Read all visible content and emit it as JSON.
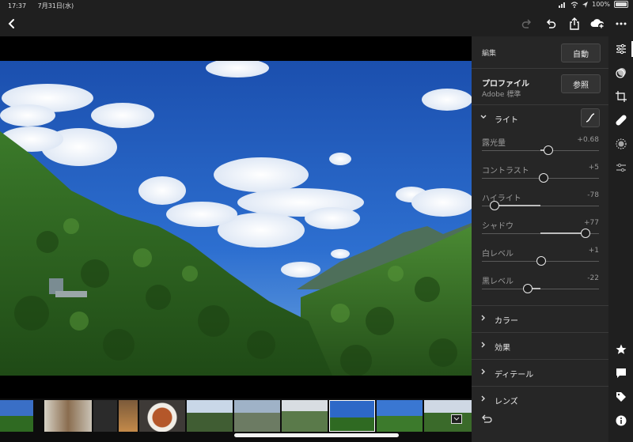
{
  "status": {
    "time": "17:37",
    "date": "7月31日(水)",
    "battery": "100%"
  },
  "toolbar": {
    "back_icon": "chevron-left-icon",
    "redo_icon": "redo-icon",
    "undo_icon": "undo-icon",
    "share_icon": "share-icon",
    "cloud_icon": "cloud-add-icon",
    "more_icon": "more-icon"
  },
  "panel": {
    "edit_title": "編集",
    "auto_label": "自動",
    "profile_title": "プロファイル",
    "profile_value": "Adobe 標準",
    "browse_label": "参照",
    "light_label": "ライト",
    "sliders": [
      {
        "label": "露光量",
        "value": "+0.68",
        "position": 0.57
      },
      {
        "label": "コントラスト",
        "value": "+5",
        "position": 0.525
      },
      {
        "label": "ハイライト",
        "value": "-78",
        "position": 0.11
      },
      {
        "label": "シャドウ",
        "value": "+77",
        "position": 0.885
      },
      {
        "label": "白レベル",
        "value": "+1",
        "position": 0.505
      },
      {
        "label": "黒レベル",
        "value": "-22",
        "position": 0.39
      }
    ],
    "sections": [
      "カラー",
      "効果",
      "ディテール",
      "レンズ"
    ]
  },
  "rail": {
    "icons": [
      "adjust-sliders-icon",
      "presets-icon",
      "crop-icon",
      "healing-icon",
      "selective-icon",
      "versions-icon",
      "star-icon",
      "comment-icon",
      "tag-icon",
      "info-icon"
    ]
  },
  "colors": {
    "panel_bg": "#262626",
    "toolbar_bg": "#1f1f1f",
    "sky": "#1f5fbf",
    "forest": "#2f6a22"
  }
}
